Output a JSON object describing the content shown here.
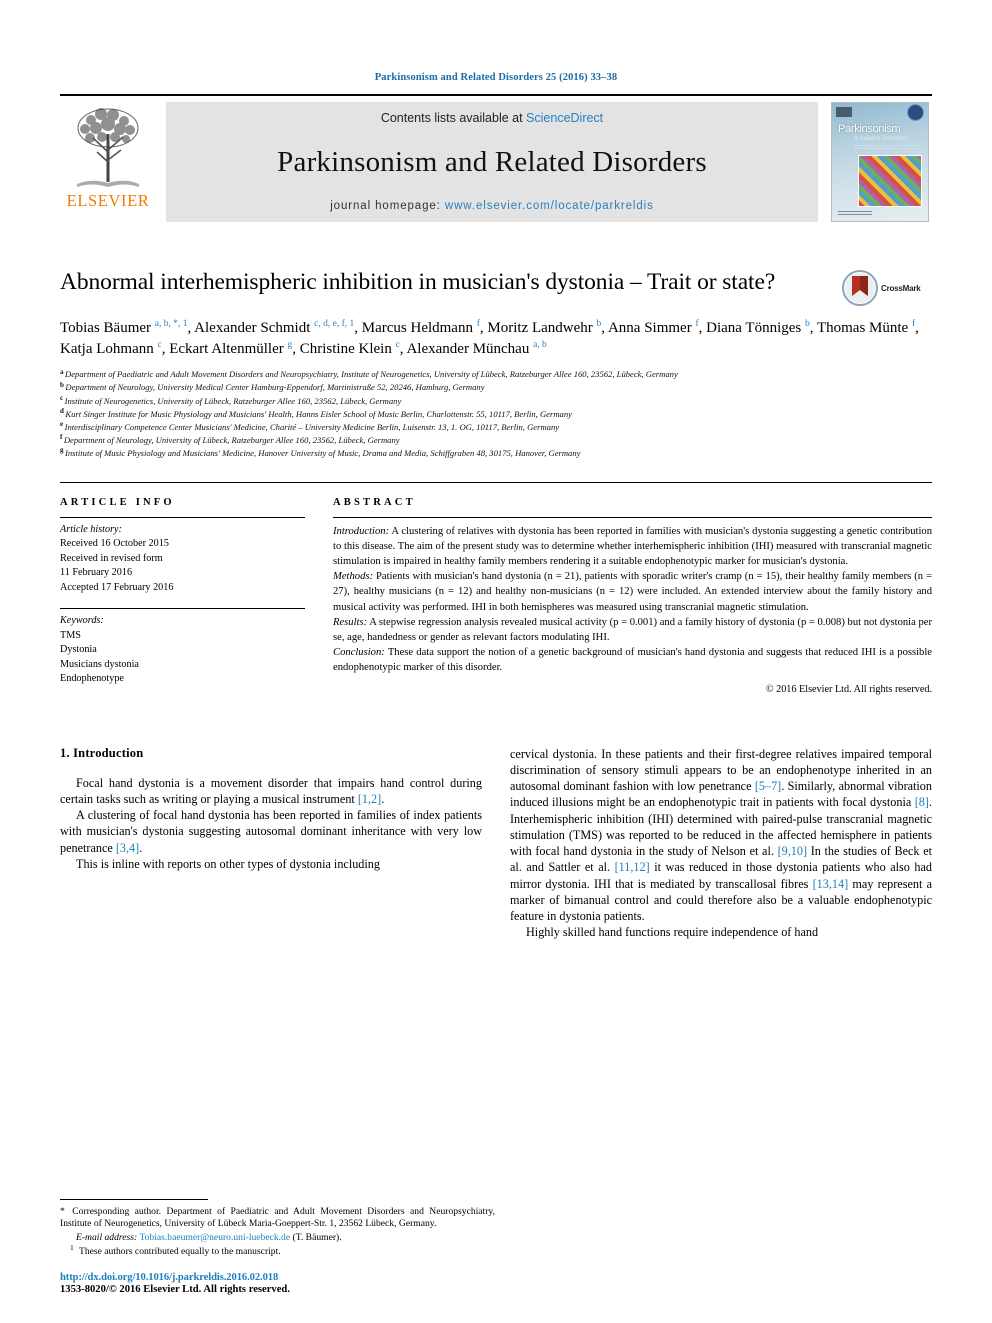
{
  "running_head": "Parkinsonism and Related Disorders 25 (2016) 33–38",
  "masthead": {
    "publisher": "ELSEVIER",
    "contents_prefix": "Contents lists available at ",
    "contents_link": "ScienceDirect",
    "journal_title": "Parkinsonism and Related Disorders",
    "homepage_label": "journal homepage: ",
    "homepage_url": "www.elsevier.com/locate/parkreldis",
    "cover": {
      "title": "Parkinsonism",
      "subtitle": "& Related Disorders"
    }
  },
  "article": {
    "title": "Abnormal interhemispheric inhibition in musician's dystonia – Trait or state?",
    "crossmark_label": "CrossMark",
    "authors_html": "Tobias Bäumer <sup>a, b, *, 1</sup>, Alexander Schmidt <sup>c, d, e, f, 1</sup>, Marcus Heldmann <sup>f</sup>, Moritz Landwehr <sup>b</sup>, Anna Simmer <sup>f</sup>, Diana Tönniges <sup>b</sup>, Thomas Münte <sup>f</sup>, Katja Lohmann <sup>c</sup>, Eckart Altenmüller <sup>g</sup>, Christine Klein <sup>c</sup>, Alexander Münchau <sup>a, b</sup>",
    "affiliations": [
      {
        "marker": "a",
        "text": "Department of Paediatric and Adult Movement Disorders and Neuropsychiatry, Institute of Neurogenetics, University of Lübeck, Ratzeburger Allee 160, 23562, Lübeck, Germany"
      },
      {
        "marker": "b",
        "text": "Department of Neurology, University Medical Center Hamburg-Eppendorf, Martinistraße 52, 20246, Hamburg, Germany"
      },
      {
        "marker": "c",
        "text": "Institute of Neurogenetics, University of Lübeck, Ratzeburger Allee 160, 23562, Lübeck, Germany"
      },
      {
        "marker": "d",
        "text": "Kurt Singer Institute for Music Physiology and Musicians' Health, Hanns Eisler School of Music Berlin, Charlottenstr. 55, 10117, Berlin, Germany"
      },
      {
        "marker": "e",
        "text": "Interdisciplinary Competence Center Musicians' Medicine, Charité – University Medicine Berlin, Luisenstr. 13, 1. OG, 10117, Berlin, Germany"
      },
      {
        "marker": "f",
        "text": "Department of Neurology, University of Lübeck, Ratzeburger Allee 160, 23562, Lübeck, Germany"
      },
      {
        "marker": "g",
        "text": "Institute of Music Physiology and Musicians' Medicine, Hanover University of Music, Drama and Media, Schiffgraben 48, 30175, Hanover, Germany"
      }
    ]
  },
  "article_info": {
    "heading": "ARTICLE INFO",
    "history_label": "Article history:",
    "history_lines": [
      "Received 16 October 2015",
      "Received in revised form",
      "11 February 2016",
      "Accepted 17 February 2016"
    ],
    "keywords_label": "Keywords:",
    "keywords": [
      "TMS",
      "Dystonia",
      "Musicians dystonia",
      "Endophenotype"
    ]
  },
  "abstract": {
    "heading": "ABSTRACT",
    "sections": [
      {
        "label": "Introduction:",
        "text": "A clustering of relatives with dystonia has been reported in families with musician's dystonia suggesting a genetic contribution to this disease. The aim of the present study was to determine whether interhemispheric inhibition (IHI) measured with transcranial magnetic stimulation is impaired in healthy family members rendering it a suitable endophenotypic marker for musician's dystonia."
      },
      {
        "label": "Methods:",
        "text": "Patients with musician's hand dystonia (n = 21), patients with sporadic writer's cramp (n = 15), their healthy family members (n = 27), healthy musicians (n = 12) and healthy non-musicians (n = 12) were included. An extended interview about the family history and musical activity was performed. IHI in both hemispheres was measured using transcranial magnetic stimulation."
      },
      {
        "label": "Results:",
        "text": "A stepwise regression analysis revealed musical activity (p = 0.001) and a family history of dystonia (p = 0.008) but not dystonia per se, age, handedness or gender as relevant factors modulating IHI."
      },
      {
        "label": "Conclusion:",
        "text": "These data support the notion of a genetic background of musician's hand dystonia and suggests that reduced IHI is a possible endophenotypic marker of this disorder."
      }
    ],
    "copyright": "© 2016 Elsevier Ltd. All rights reserved."
  },
  "body": {
    "section_number_title": "1. Introduction",
    "left_paragraphs": [
      "Focal hand dystonia is a movement disorder that impairs hand control during certain tasks such as writing or playing a musical instrument [1,2].",
      "A clustering of focal hand dystonia has been reported in families of index patients with musician's dystonia suggesting autosomal dominant inheritance with very low penetrance [3,4].",
      "This is inline with reports on other types of dystonia including"
    ],
    "right_paragraphs": [
      "cervical dystonia. In these patients and their first-degree relatives impaired temporal discrimination of sensory stimuli appears to be an endophenotype inherited in an autosomal dominant fashion with low penetrance [5–7]. Similarly, abnormal vibration induced illusions might be an endophenotypic trait in patients with focal dystonia [8]. Interhemispheric inhibition (IHI) determined with paired-pulse transcranial magnetic stimulation (TMS) was reported to be reduced in the affected hemisphere in patients with focal hand dystonia in the study of Nelson et al. [9,10] In the studies of Beck et al. and Sattler et al. [11,12] it was reduced in those dystonia patients who also had mirror dystonia. IHI that is mediated by transcallosal fibres [13,14] may represent a marker of bimanual control and could therefore also be a valuable endophenotypic feature in dystonia patients.",
      "Highly skilled hand functions require independence of hand"
    ]
  },
  "footnotes": {
    "corresponding_star": "*",
    "corresponding_text": "Corresponding author. Department of Paediatric and Adult Movement Disorders and Neuropsychiatry, Institute of Neurogenetics, University of Lübeck Maria-Goeppert-Str. 1, 23562 Lübeck, Germany.",
    "email_label": "E-mail address:",
    "email": "Tobias.baeumer@neuro.uni-luebeck.de",
    "email_suffix": "(T. Bäumer).",
    "equal_marker": "1",
    "equal_text": "These authors contributed equally to the manuscript."
  },
  "footer": {
    "doi": "http://dx.doi.org/10.1016/j.parkreldis.2016.02.018",
    "issn_line": "1353-8020/© 2016 Elsevier Ltd. All rights reserved."
  },
  "colors": {
    "link": "#1b7fbf",
    "header_blue": "#1b6ca8",
    "elsevier_orange": "#f07c00",
    "band_grey": "#e3e3e3"
  }
}
